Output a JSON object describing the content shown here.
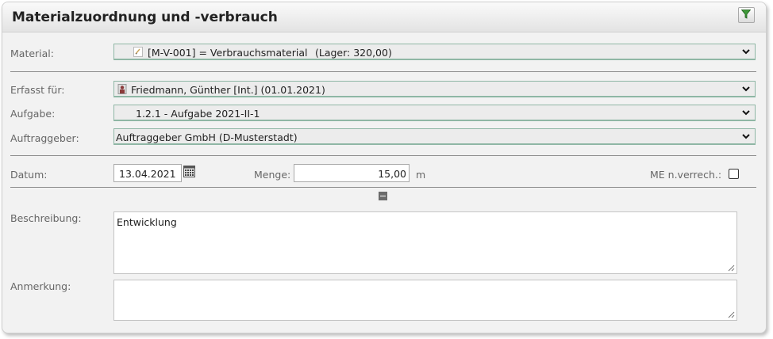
{
  "panel": {
    "title": "Materialzuordnung und -verbrauch",
    "filter_icon": "filter-icon"
  },
  "form": {
    "material": {
      "label": "Material:",
      "value": "[M-V-001] = Verbrauchsmaterial",
      "stock": "(Lager: 320,00)",
      "icon": "material-icon"
    },
    "erfasst_fuer": {
      "label": "Erfasst für:",
      "value": "Friedmann, Günther [Int.] (01.01.2021)",
      "icon": "person-icon"
    },
    "aufgabe": {
      "label": "Aufgabe:",
      "value": "1.2.1 - Aufgabe 2021-II-1"
    },
    "auftraggeber": {
      "label": "Auftraggeber:",
      "value": "Auftraggeber GmbH (D-Musterstadt)"
    },
    "datum": {
      "label": "Datum:",
      "value": "13.04.2021",
      "icon": "calendar-icon"
    },
    "menge": {
      "label": "Menge:",
      "value": "15,00",
      "unit": "m"
    },
    "me_nverrech": {
      "label": "ME n.verrech.:",
      "checked": false
    },
    "beschreibung": {
      "label": "Beschreibung:",
      "value": "Entwicklung"
    },
    "anmerkung": {
      "label": "Anmerkung:",
      "value": ""
    }
  },
  "colors": {
    "accent_green": "#6aa38a",
    "filter_green": "#3f9a3a"
  }
}
